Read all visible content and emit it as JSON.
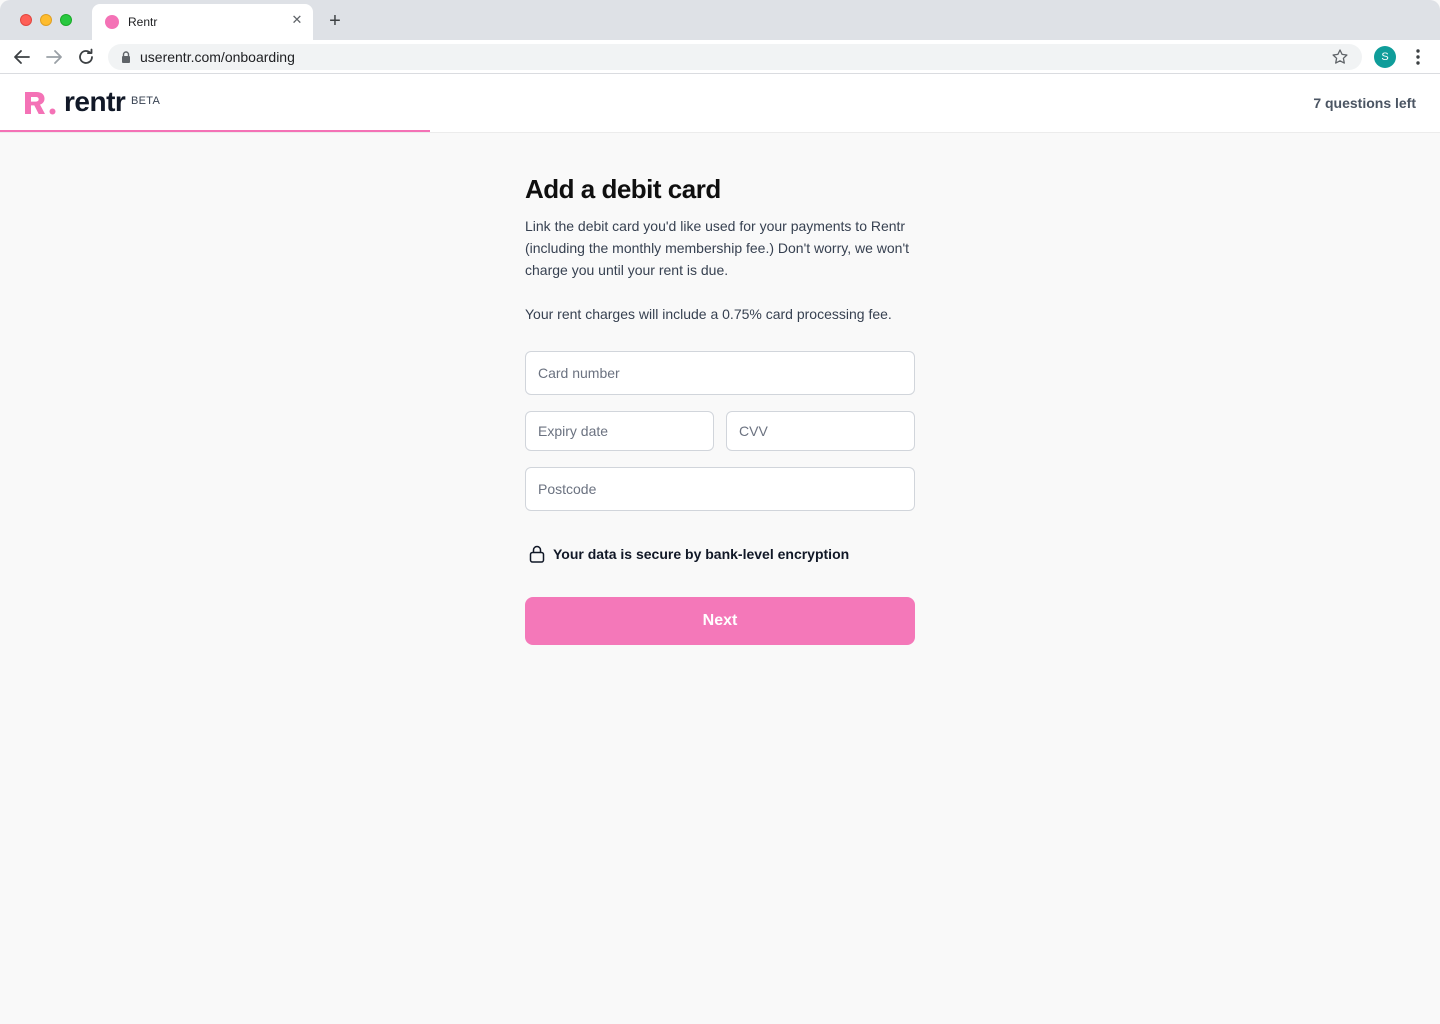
{
  "browser": {
    "tab_title": "Rentr",
    "tab_close_icon": "close-icon",
    "url": "userentr.com/onboarding",
    "profile_initial": "S",
    "colors": {
      "favicon": "#f472b6",
      "profile": "#0f9d9a"
    }
  },
  "header": {
    "logo_text": "rentr",
    "beta_label": "BETA",
    "questions_left": "7 questions left",
    "progress": 0.2986,
    "colors": {
      "brand": "#f472b6"
    }
  },
  "form": {
    "title": "Add a debit card",
    "description": "Link the debit card you'd like used for your payments to Rentr (including the monthly membership fee.) Don't worry, we won't charge you until your rent is due.",
    "fee_note": "Your rent charges will include a 0.75% card processing fee.",
    "card_number": {
      "placeholder": "Card number",
      "value": ""
    },
    "expiry": {
      "placeholder": "Expiry date",
      "value": ""
    },
    "cvv": {
      "placeholder": "CVV",
      "value": ""
    },
    "postcode": {
      "placeholder": "Postcode",
      "value": ""
    },
    "security_note": "Your data is secure by bank-level encryption",
    "next_label": "Next",
    "colors": {
      "button": "#f478b9"
    }
  }
}
